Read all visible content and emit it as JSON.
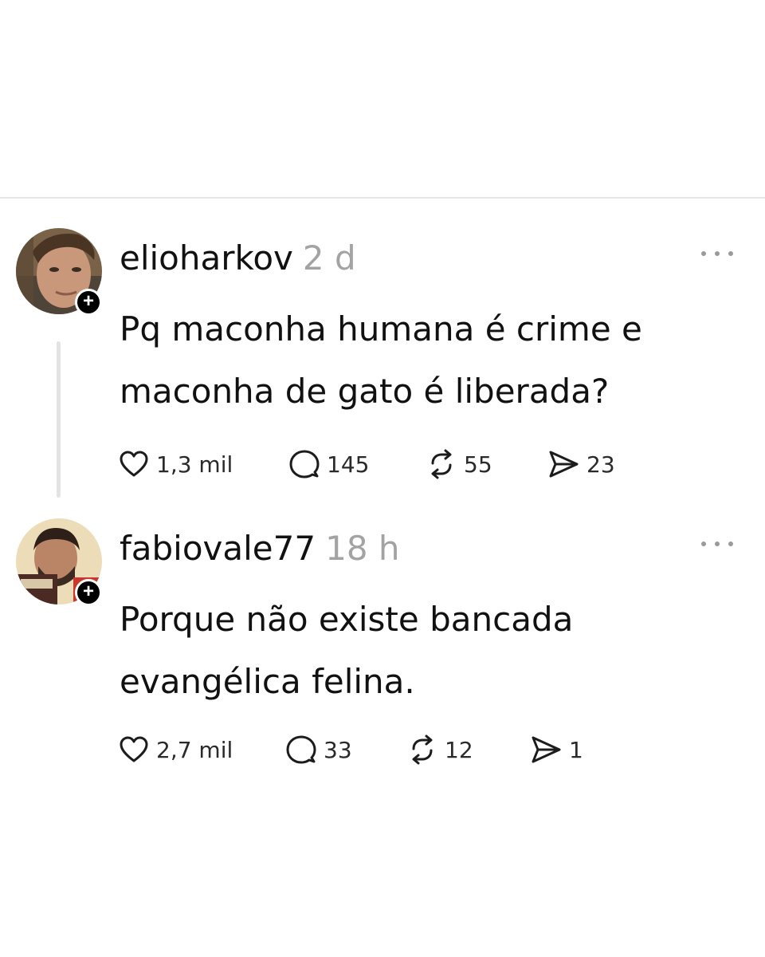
{
  "posts": [
    {
      "username": "elioharkov",
      "time": "2 d",
      "text": "Pq maconha humana é crime e maconha de gato é liberada?",
      "likes": "1,3 mil",
      "replies": "145",
      "reposts": "55",
      "shares": "23"
    },
    {
      "username": "fabiovale77",
      "time": "18 h",
      "text": "Porque não existe bancada evangélica felina.",
      "likes": "2,7 mil",
      "replies": "33",
      "reposts": "12",
      "shares": "1"
    }
  ],
  "follow_symbol": "+",
  "icons": {
    "like": "heart-icon",
    "reply": "speech-bubble-icon",
    "repost": "repost-arrows-icon",
    "share": "send-icon",
    "more": "more-dots-icon",
    "follow": "plus-icon"
  },
  "colors": {
    "text": "#111111",
    "muted": "#a3a3a3",
    "divider": "#e6e6e6",
    "badge": "#000000"
  }
}
